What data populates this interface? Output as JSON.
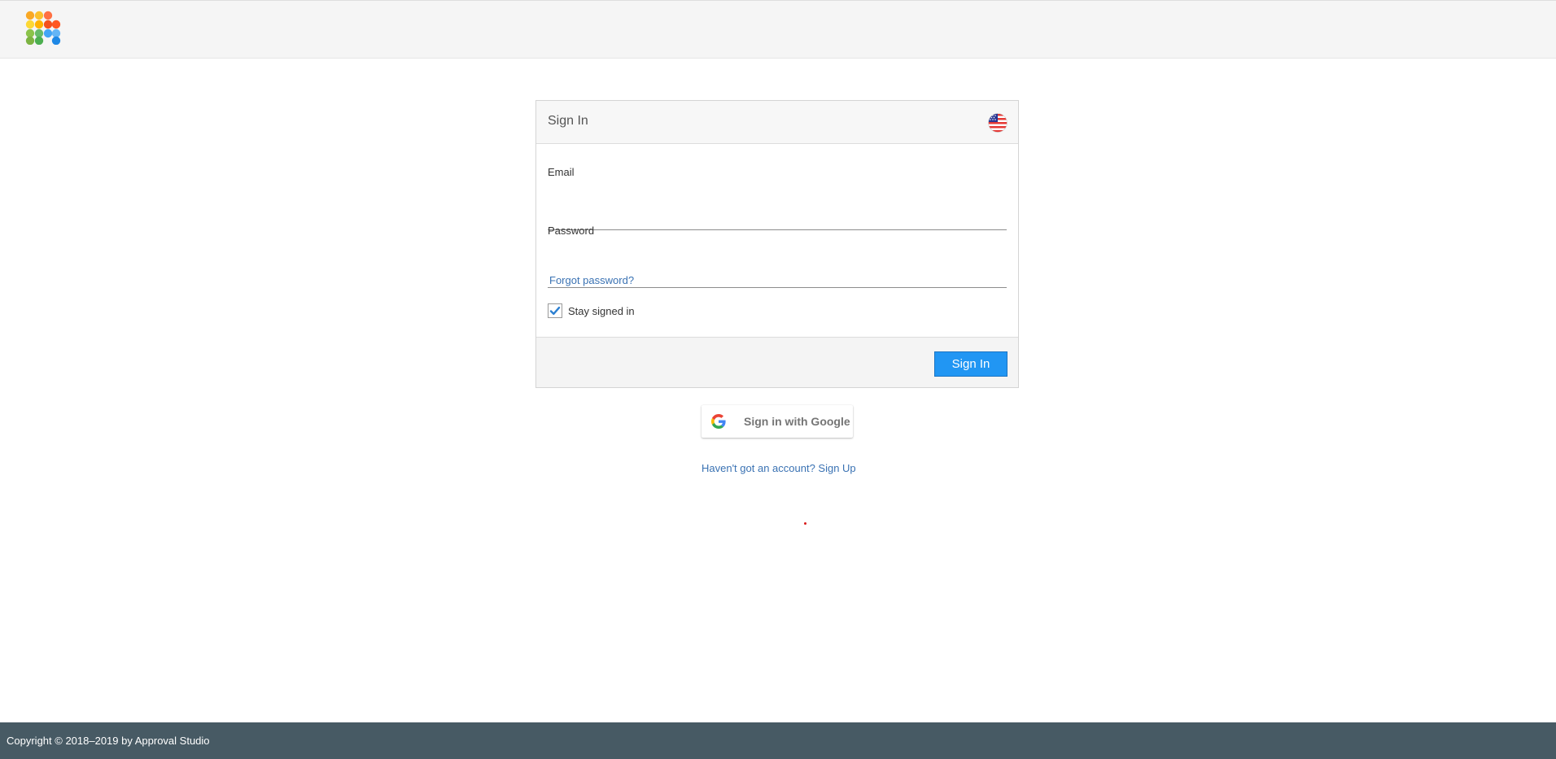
{
  "header": {
    "logo_icon": "approval-studio-logo-icon"
  },
  "signin_card": {
    "title": "Sign In",
    "language_icon": "us-flag-icon",
    "email": {
      "label": "Email",
      "value": "",
      "placeholder": ""
    },
    "password": {
      "label": "Password",
      "value": "",
      "placeholder": ""
    },
    "forgot_password": "Forgot password?",
    "stay_signed_in": {
      "label": "Stay signed in",
      "checked": true
    },
    "submit_label": "Sign In"
  },
  "google_signin": {
    "icon": "google-g-icon",
    "label": "Sign in with Google"
  },
  "signup_link": "Haven't got an account? Sign Up",
  "footer": {
    "copyright": "Copyright © 2018–2019 by Approval Studio"
  },
  "colors": {
    "primary_button": "#2196f3",
    "link": "#3a72b3",
    "footer_bg": "#475a64",
    "header_bg": "#f5f5f5"
  }
}
